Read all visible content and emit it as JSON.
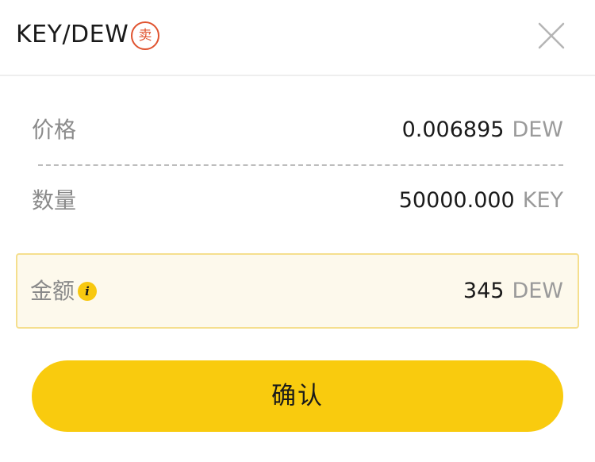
{
  "header": {
    "pair": "KEY/DEW",
    "side_badge": "卖",
    "close_icon": "close-icon"
  },
  "order": {
    "price": {
      "label": "价格",
      "value": "0.006895",
      "unit": "DEW"
    },
    "quantity": {
      "label": "数量",
      "value": "50000.000",
      "unit": "KEY"
    },
    "amount": {
      "label": "金额",
      "info_icon": "info-icon",
      "info_glyph": "i",
      "value": "345",
      "unit": "DEW"
    }
  },
  "confirm_label": "确认",
  "colors": {
    "accent": "#f9cb0e",
    "sell": "#e0532f",
    "amount_bg": "#fdf9ec",
    "amount_border": "#f5df8e",
    "muted_text": "#8a8a8a"
  }
}
